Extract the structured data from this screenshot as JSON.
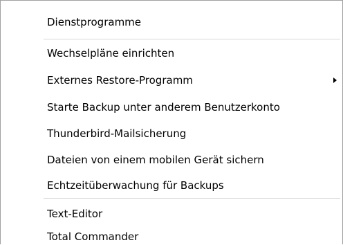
{
  "menu": {
    "items": [
      {
        "label": "Dienstprogramme"
      },
      {
        "label": "Wechselpläne einrichten"
      },
      {
        "label": "Externes Restore-Programm",
        "submenu": true
      },
      {
        "label": "Starte Backup unter anderem Benutzerkonto"
      },
      {
        "label": "Thunderbird-Mailsicherung"
      },
      {
        "label": "Dateien von einem mobilen Gerät sichern"
      },
      {
        "label": "Echtzeitüberwachung für Backups"
      },
      {
        "label": "Text-Editor"
      },
      {
        "label": "Total Commander"
      }
    ],
    "submenu_icon": "chevron-right-icon"
  }
}
